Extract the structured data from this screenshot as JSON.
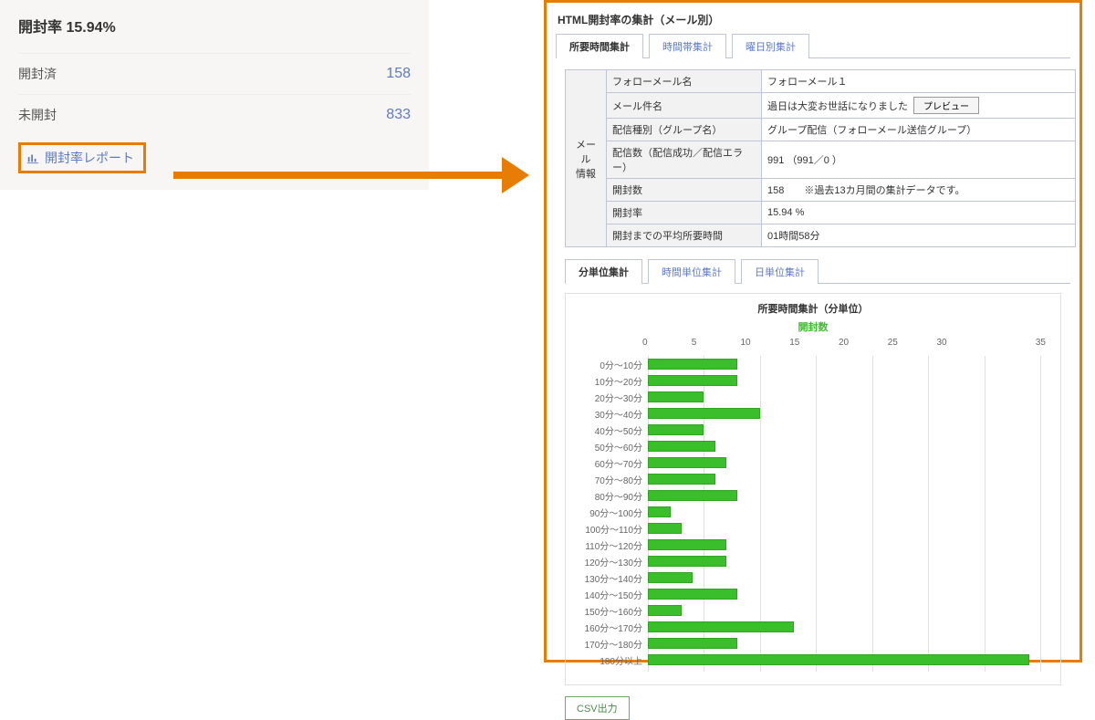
{
  "left": {
    "title": "開封率 15.94%",
    "opened_label": "開封済",
    "opened_value": "158",
    "unopened_label": "未開封",
    "unopened_value": "833",
    "report_link": "開封率レポート"
  },
  "panel": {
    "title": "HTML開封率の集計（メール別）",
    "tabs1": [
      "所要時間集計",
      "時間帯集計",
      "曜日別集計"
    ],
    "active1": 0,
    "info": {
      "side": "メール\n情報",
      "rows": [
        {
          "label": "フォローメール名",
          "value": "フォローメール１"
        },
        {
          "label": "メール件名",
          "value": "過日は大変お世話になりました",
          "preview": "プレビュー"
        },
        {
          "label": "配信種別（グループ名）",
          "value": "グループ配信（フォローメール送信グループ）"
        },
        {
          "label": "配信数（配信成功／配信エラー）",
          "value": "991 （991／0 ）"
        },
        {
          "label": "開封数",
          "value": "158　　※過去13カ月間の集計データです。"
        },
        {
          "label": "開封率",
          "value": "15.94 %"
        },
        {
          "label": "開封までの平均所要時間",
          "value": "01時間58分"
        }
      ]
    },
    "tabs2": [
      "分単位集計",
      "時間単位集計",
      "日単位集計"
    ],
    "active2": 0,
    "csv": "CSV出力"
  },
  "chart_data": {
    "type": "bar",
    "orientation": "horizontal",
    "title": "所要時間集計（分単位）",
    "legend": "開封数",
    "xlabel": "",
    "ylabel": "",
    "xlim": [
      0,
      35
    ],
    "ticks": [
      0,
      5,
      10,
      15,
      20,
      25,
      30,
      35
    ],
    "categories": [
      "0分～10分",
      "10分～20分",
      "20分～30分",
      "30分～40分",
      "40分～50分",
      "50分～60分",
      "60分～70分",
      "70分～80分",
      "80分～90分",
      "90分～100分",
      "100分～110分",
      "110分～120分",
      "120分～130分",
      "130分～140分",
      "140分～150分",
      "150分～160分",
      "160分～170分",
      "170分～180分",
      "180分以上"
    ],
    "values": [
      8,
      8,
      5,
      10,
      5,
      6,
      7,
      6,
      8,
      2,
      3,
      7,
      7,
      4,
      8,
      3,
      13,
      8,
      34
    ]
  }
}
